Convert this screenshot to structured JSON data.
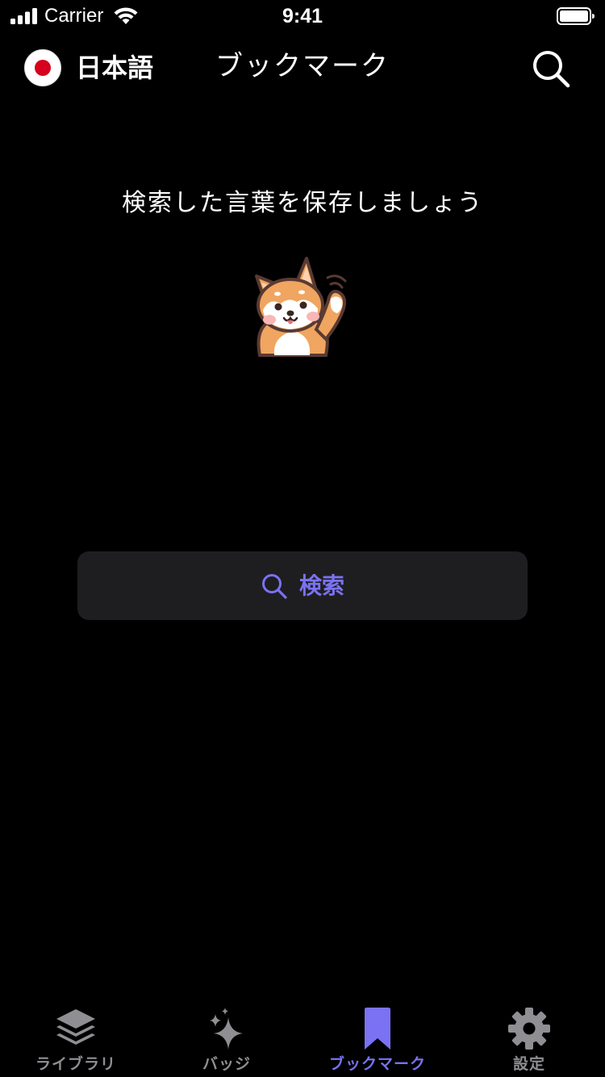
{
  "status_bar": {
    "carrier": "Carrier",
    "time": "9:41"
  },
  "nav": {
    "language": "日本語",
    "title": "ブックマーク",
    "flag_icon": "japan-flag-icon",
    "search_icon": "search-icon"
  },
  "empty_state": {
    "message": "検索した言葉を保存しましょう",
    "illustration": "shiba-dog-waving-icon",
    "search_button_label": "検索"
  },
  "tabs": [
    {
      "label": "ライブラリ",
      "icon": "stack-layers-icon",
      "active": false
    },
    {
      "label": "バッジ",
      "icon": "sparkle-icon",
      "active": false
    },
    {
      "label": "ブックマーク",
      "icon": "bookmark-icon",
      "active": true
    },
    {
      "label": "設定",
      "icon": "gear-icon",
      "active": false
    }
  ],
  "colors": {
    "accent": "#7a72f2",
    "inactive": "#8e8e93",
    "background": "#000000",
    "button_bg": "#1e1e20",
    "flag_red": "#d7001d"
  }
}
